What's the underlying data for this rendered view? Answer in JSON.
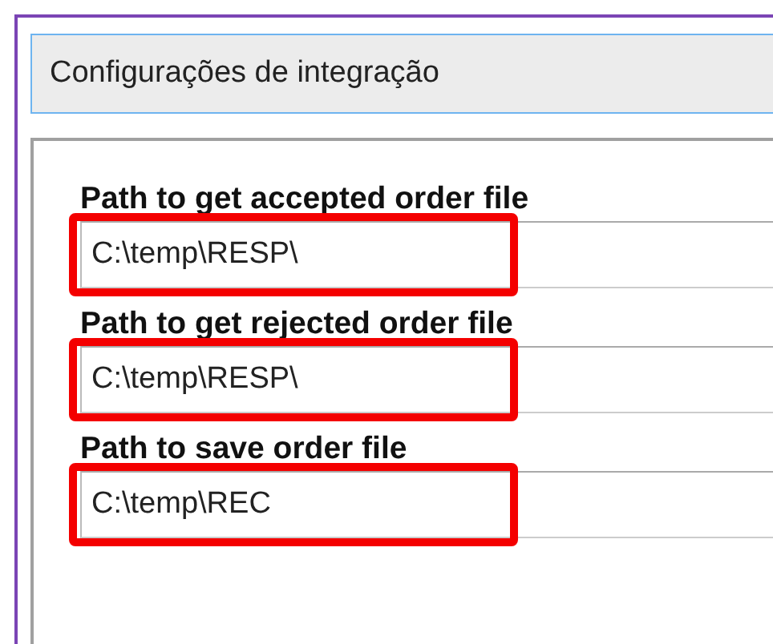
{
  "header": {
    "title": "Configurações de integração"
  },
  "fields": [
    {
      "label": "Path to get accepted order file",
      "value": "C:\\temp\\RESP\\",
      "highlighted": true
    },
    {
      "label": "Path to get rejected order file",
      "value": "C:\\temp\\RESP\\",
      "highlighted": true
    },
    {
      "label": "Path to save order file",
      "value": "C:\\temp\\REC",
      "highlighted": true
    }
  ]
}
